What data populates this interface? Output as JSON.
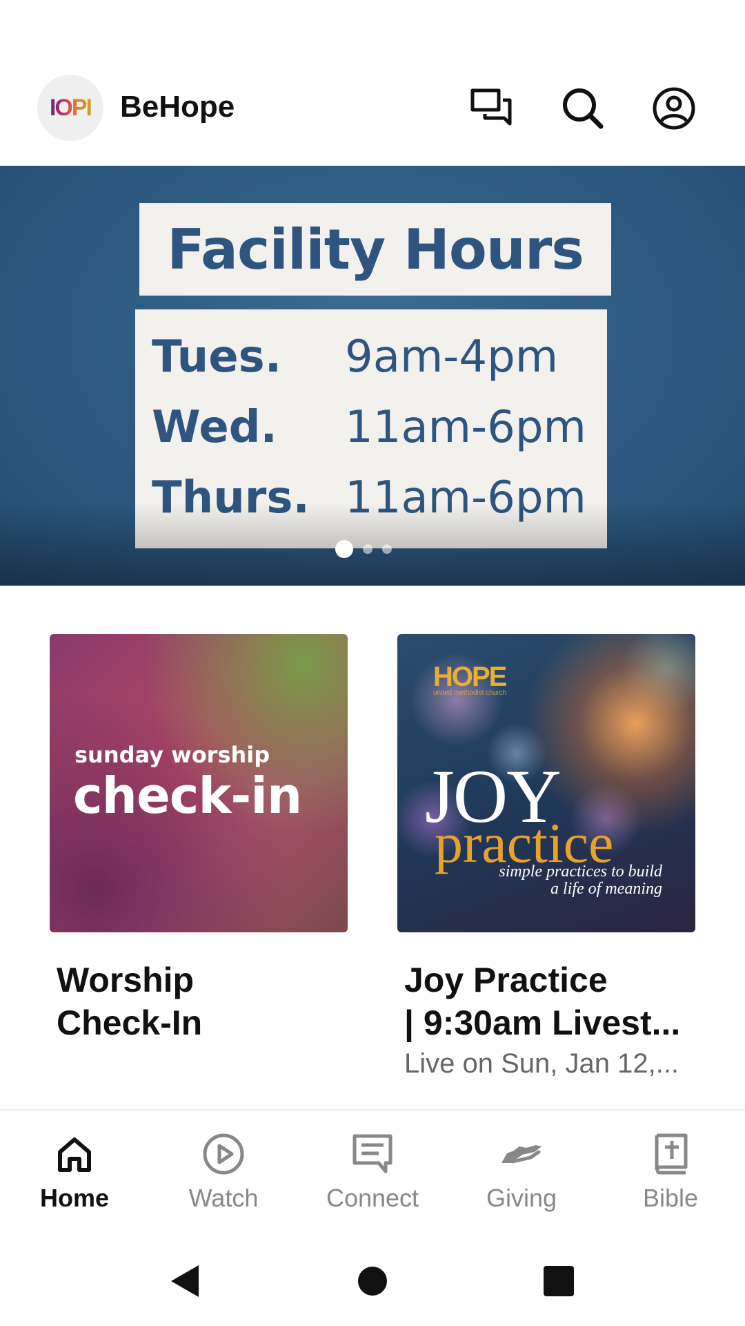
{
  "app": {
    "logo_text": "IOPI",
    "title": "BeHope"
  },
  "header_icons": [
    "chat-icon",
    "search-icon",
    "account-icon"
  ],
  "hero": {
    "title": "Facility Hours",
    "hours": [
      {
        "day": "Tues.",
        "time": "9am-4pm"
      },
      {
        "day": "Wed.",
        "time": "11am-6pm"
      },
      {
        "day": "Thurs.",
        "time": "11am-6pm"
      }
    ],
    "page_count": 3,
    "active_page": 1
  },
  "cards": [
    {
      "image": {
        "small_text": "sunday worship",
        "big_text": "check-in"
      },
      "title_lines": [
        "Worship",
        "Check-In"
      ],
      "subtitle": ""
    },
    {
      "image": {
        "brand": "HOPE",
        "brand_sub": "united methodist church",
        "big_text": "JOY",
        "script_text": "practice",
        "tagline_1": "simple practices to build",
        "tagline_2": "a life of meaning"
      },
      "title_lines": [
        "Joy Practice",
        "| 9:30am Livest..."
      ],
      "subtitle": "Live on Sun, Jan 12,..."
    }
  ],
  "bottom_nav": [
    {
      "label": "Home",
      "icon": "home-icon",
      "active": true
    },
    {
      "label": "Watch",
      "icon": "play-circle-icon",
      "active": false
    },
    {
      "label": "Connect",
      "icon": "message-icon",
      "active": false
    },
    {
      "label": "Giving",
      "icon": "giving-hand-icon",
      "active": false
    },
    {
      "label": "Bible",
      "icon": "bible-icon",
      "active": false
    }
  ],
  "colors": {
    "hero_blue": "#2e5a82",
    "hero_text": "#2d5580",
    "active_nav": "#111111",
    "inactive_nav": "#888888"
  }
}
